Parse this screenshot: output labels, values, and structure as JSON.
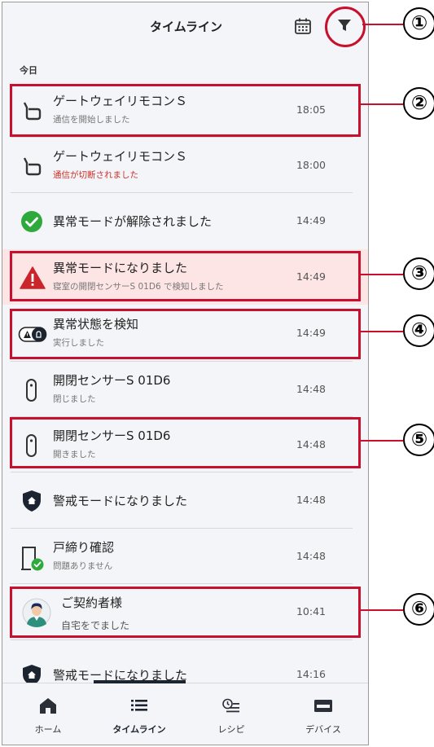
{
  "header": {
    "title": "タイムライン"
  },
  "section_label": "今日",
  "rows": [
    {
      "title": "ゲートウェイリモコンＳ",
      "subtitle": "通信を開始しました",
      "time": "18:05",
      "icon": "gateway-remote-icon"
    },
    {
      "title": "ゲートウェイリモコンＳ",
      "subtitle": "通信が切断されました",
      "time": "18:00",
      "icon": "gateway-remote-icon"
    },
    {
      "title": "異常モードが解除されました",
      "time": "14:49",
      "icon": "check-circle-icon"
    },
    {
      "title": "異常モードになりました",
      "subtitle": "寝室の開閉センサーS 01D6 で検知しました",
      "time": "14:49",
      "icon": "warning-icon"
    },
    {
      "title": "異常状態を検知",
      "subtitle": "実行しました",
      "time": "14:49",
      "icon": "alarm-recipe-icon"
    },
    {
      "title": "開閉センサーS 01D6",
      "subtitle": "閉じました",
      "time": "14:48",
      "icon": "open-close-sensor-icon"
    },
    {
      "title": "開閉センサーS 01D6",
      "subtitle": "開きました",
      "time": "14:48",
      "icon": "open-close-sensor-icon"
    },
    {
      "title": "警戒モードになりました",
      "time": "14:48",
      "icon": "security-shield-icon"
    },
    {
      "title": "戸締り確認",
      "subtitle": "問題ありません",
      "time": "14:48",
      "icon": "door-check-icon"
    },
    {
      "title": "ご契約者様",
      "subtitle": "自宅をでました",
      "time": "10:41",
      "icon": "user-avatar-icon"
    },
    {
      "title": "警戒モードになりました",
      "time": "14:16",
      "icon": "security-shield-icon"
    }
  ],
  "nav": [
    {
      "label": "ホーム",
      "icon": "home-icon"
    },
    {
      "label": "タイムライン",
      "icon": "timeline-list-icon"
    },
    {
      "label": "レシピ",
      "icon": "recipe-icon"
    },
    {
      "label": "デバイス",
      "icon": "device-icon"
    }
  ],
  "annotations": [
    "①",
    "②",
    "③",
    "④",
    "⑤",
    "⑥"
  ],
  "colors": {
    "accent": "#1b2430",
    "alert_bg": "#fde5e5",
    "annotation_red": "#c8102e",
    "check_green": "#2eaa3c",
    "warning_red": "#c9252b",
    "disconnect_red": "#d0302a"
  }
}
